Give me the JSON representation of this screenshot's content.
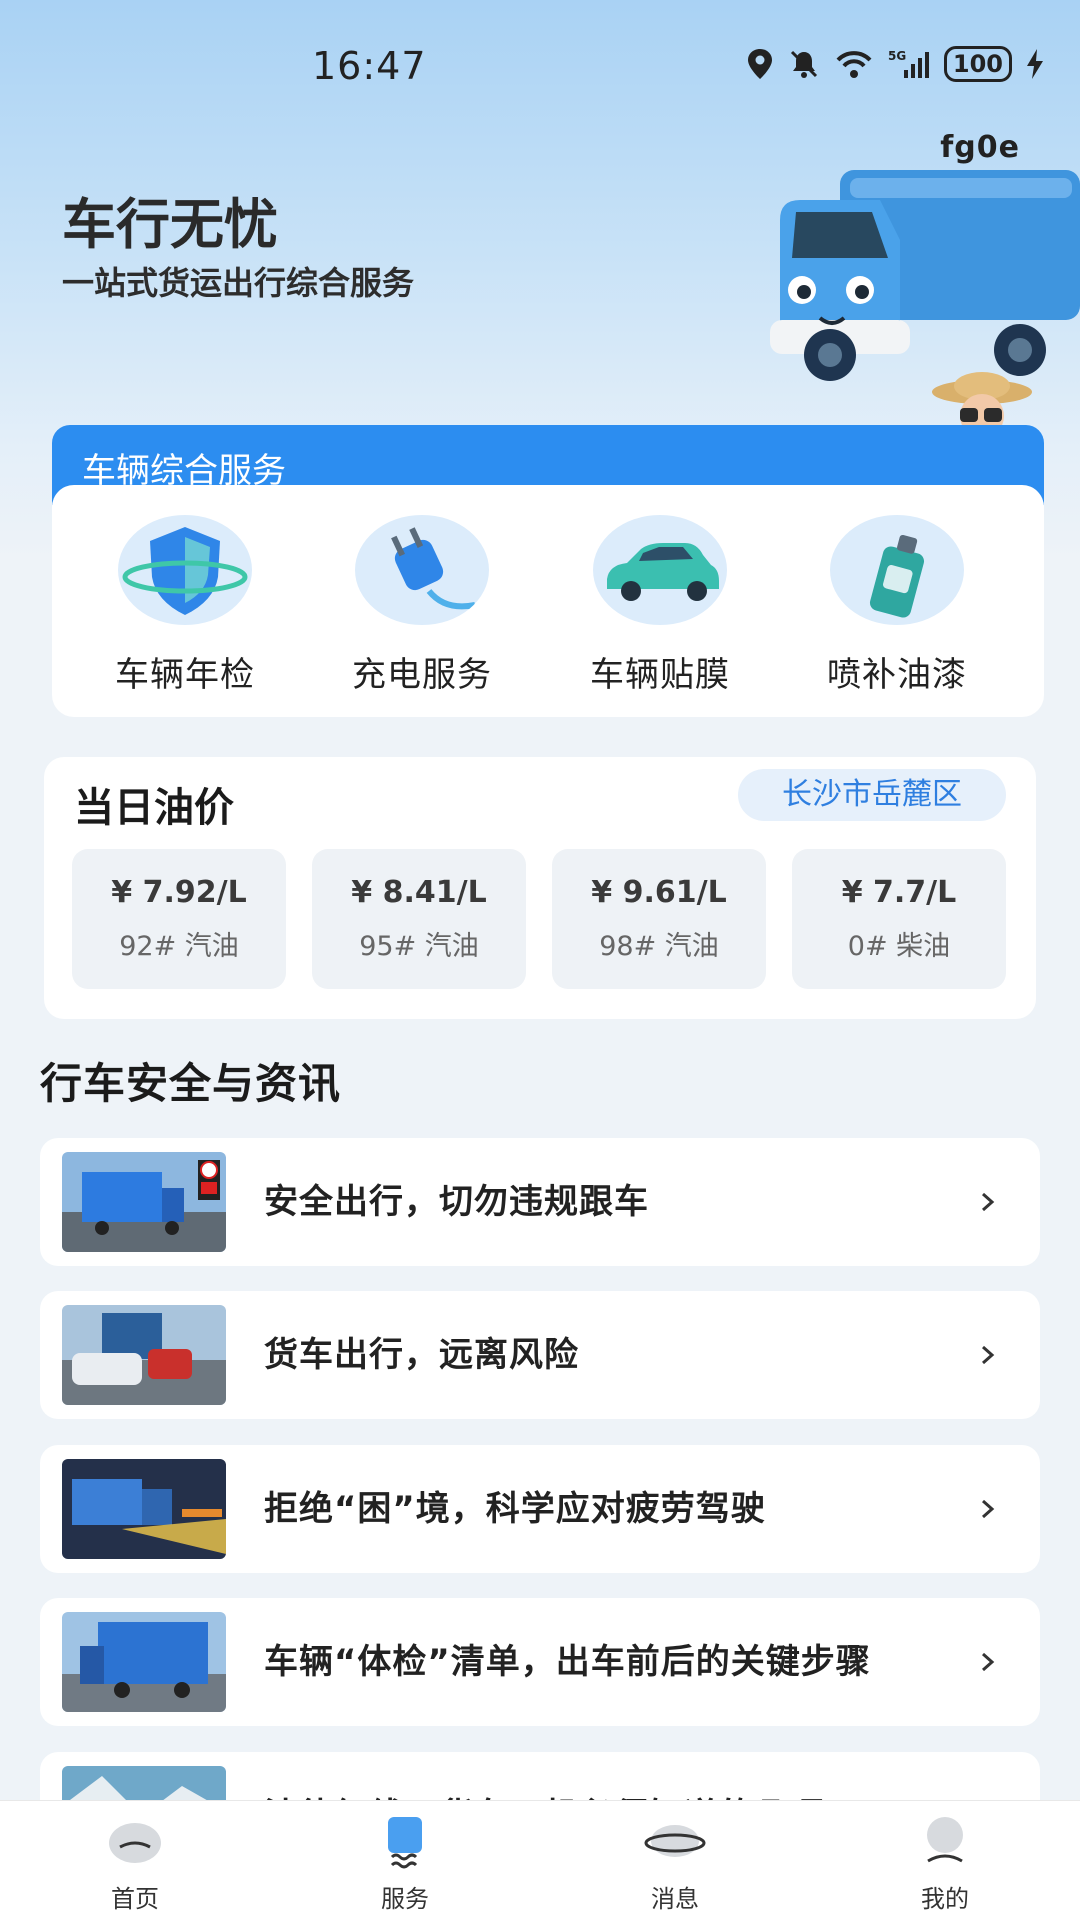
{
  "status": {
    "time": "16:47",
    "battery": "100"
  },
  "hero": {
    "id_label": "fg0e",
    "title": "车行无忧",
    "subtitle": "一站式货运出行综合服务"
  },
  "services": {
    "title": "车辆综合服务",
    "items": [
      {
        "label": "车辆年检",
        "icon": "shield-icon"
      },
      {
        "label": "充电服务",
        "icon": "plug-icon"
      },
      {
        "label": "车辆贴膜",
        "icon": "car-icon"
      },
      {
        "label": "喷补油漆",
        "icon": "spray-can-icon"
      }
    ]
  },
  "oil": {
    "title": "当日油价",
    "location": "长沙市岳麓区",
    "items": [
      {
        "price": "¥ 7.92/L",
        "name": "92# 汽油"
      },
      {
        "price": "¥ 8.41/L",
        "name": "95# 汽油"
      },
      {
        "price": "¥ 9.61/L",
        "name": "98# 汽油"
      },
      {
        "price": "¥ 7.7/L",
        "name": "0# 柴油"
      }
    ]
  },
  "news": {
    "title": "行车安全与资讯",
    "items": [
      {
        "title": "安全出行，切勿违规跟车"
      },
      {
        "title": "货车出行，远离风险"
      },
      {
        "title": "拒绝“困”境，科学应对疲劳驾驶"
      },
      {
        "title": "车辆“体检”清单，出车前后的关键步骤"
      },
      {
        "title": "法律红线，货车司机必须知道的几项"
      }
    ]
  },
  "tabbar": {
    "items": [
      {
        "label": "首页"
      },
      {
        "label": "服务"
      },
      {
        "label": "消息"
      },
      {
        "label": "我的"
      }
    ],
    "active": "服务"
  },
  "colors": {
    "accent": "#2c8df0",
    "location_text": "#2f7fe0"
  }
}
